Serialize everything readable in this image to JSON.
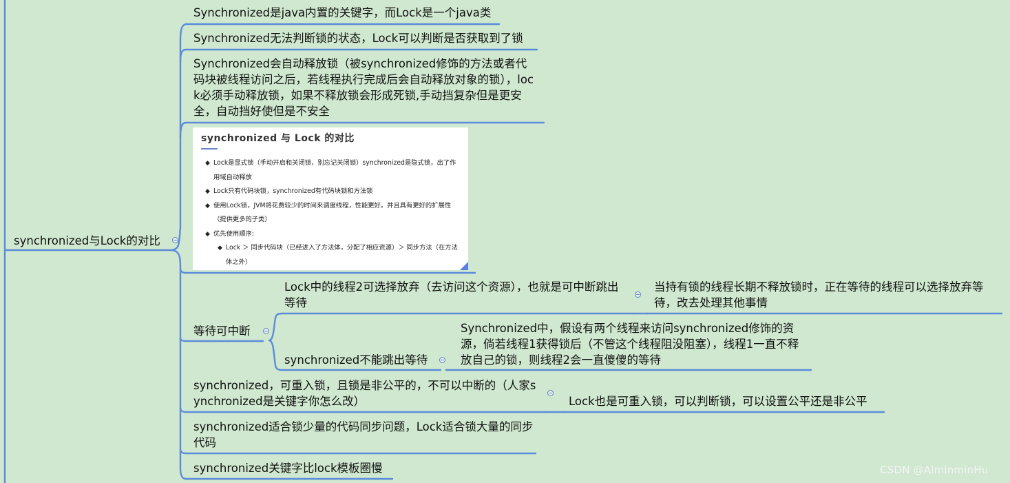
{
  "root": {
    "label": "synchronized与Lock的对比"
  },
  "branches": {
    "b1": "Synchronized是java内置的关键字，而Lock是一个java类",
    "b2": "Synchronized无法判断锁的状态，Lock可以判断是否获取到了锁",
    "b3": "Synchronized会自动释放锁（被synchronized修饰的方法或者代码块被线程访问之后，若线程执行完成后会自动释放对象的锁），lock必须手动释放锁，如果不释放锁会形成死锁,手动挡复杂但是更安全，自动挡好使但是不安全",
    "b5": "等待可中断",
    "b6": "synchronized，可重入锁，且锁是非公平的，不可以中断的（人家synchronized是关键字你怎么改）",
    "b7": "synchronized适合锁少量的代码同步问题，Lock适合锁大量的同步代码",
    "b8": "synchronized关键字比lock模板圈慢"
  },
  "sub": {
    "wait_a": "Lock中的线程2可选择放弃（去访问这个资源），也就是可中断跳出等待",
    "wait_a_detail": "当持有锁的线程长期不释放锁时，正在等待的线程可以选择放弃等待，改去处理其他事情",
    "wait_b": "synchronized不能跳出等待",
    "wait_b_detail": "Synchronized中，假设有两个线程来访问synchronized修饰的资源，倘若线程1获得锁后（不管这个线程阻没阻塞），线程1一直不释放自己的锁，则线程2会一直傻傻的等待",
    "reentrant_detail": "Lock也是可重入锁，可以判断锁，可以设置公平还是非公平"
  },
  "card": {
    "title": "synchronized 与 Lock 的对比",
    "items": [
      "Lock是显式锁（手动开启和关闭锁，别忘记关闭锁）synchronized是隐式锁，出了作用域自动释放",
      "Lock只有代码块锁，synchronized有代码块锁和方法锁",
      "使用Lock锁，JVM将花费较少的时间来调度线程，性能更好。并且具有更好的扩展性（提供更多的子类）",
      "优先使用顺序:"
    ],
    "subitem": "Lock ＞ 同步代码块（已经进入了方法体，分配了相应资源）＞ 同步方法（在方法体之外）",
    "bullet": "◆"
  },
  "watermark": "CSDN @AlminminHu",
  "colors": {
    "background": "#cfe8cf",
    "line": "#5b8bd9",
    "card_corner": "#5b7fe0"
  }
}
